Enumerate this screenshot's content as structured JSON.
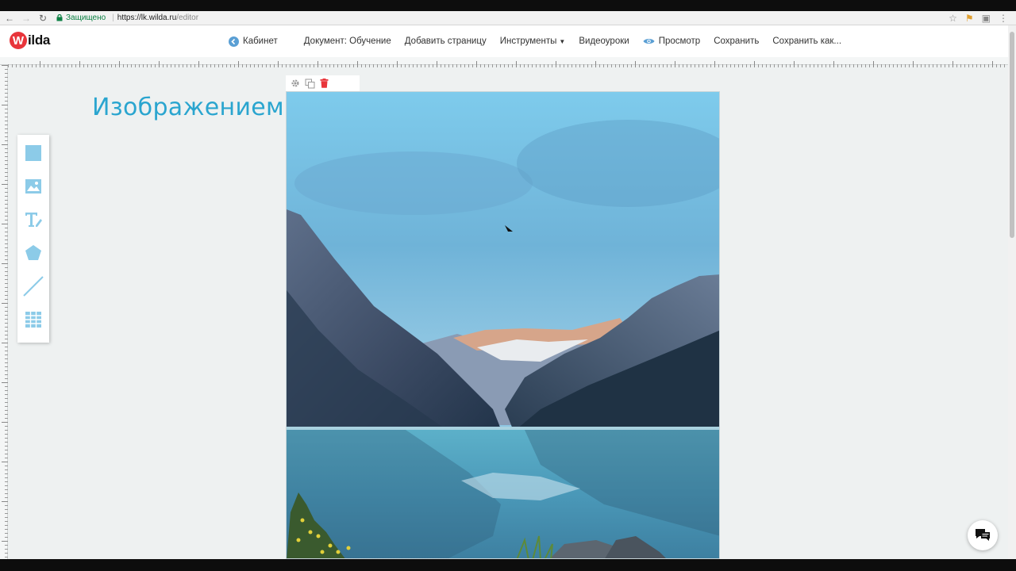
{
  "browser": {
    "secure_label": "Защищено",
    "url_host": "https://lk.wilda.ru",
    "url_path": "/editor"
  },
  "app": {
    "logo_letter": "W",
    "logo_text": "ilda",
    "menu": {
      "cabinet": "Кабинет",
      "document": "Документ: Обучение",
      "add_page": "Добавить страницу",
      "tools": "Инструменты",
      "video": "Видеоуроки",
      "preview": "Просмотр",
      "save": "Сохранить",
      "save_as": "Сохранить как..."
    },
    "accent_color": "#2aa5cf",
    "brand_color": "#e8353b"
  },
  "canvas": {
    "heading": "Изображением",
    "tools": [
      "square-tool-icon",
      "image-tool-icon",
      "text-tool-icon",
      "shape-tool-icon",
      "line-tool-icon",
      "table-tool-icon"
    ],
    "block_controls": [
      "gear-icon",
      "copy-icon",
      "trash-icon"
    ]
  }
}
